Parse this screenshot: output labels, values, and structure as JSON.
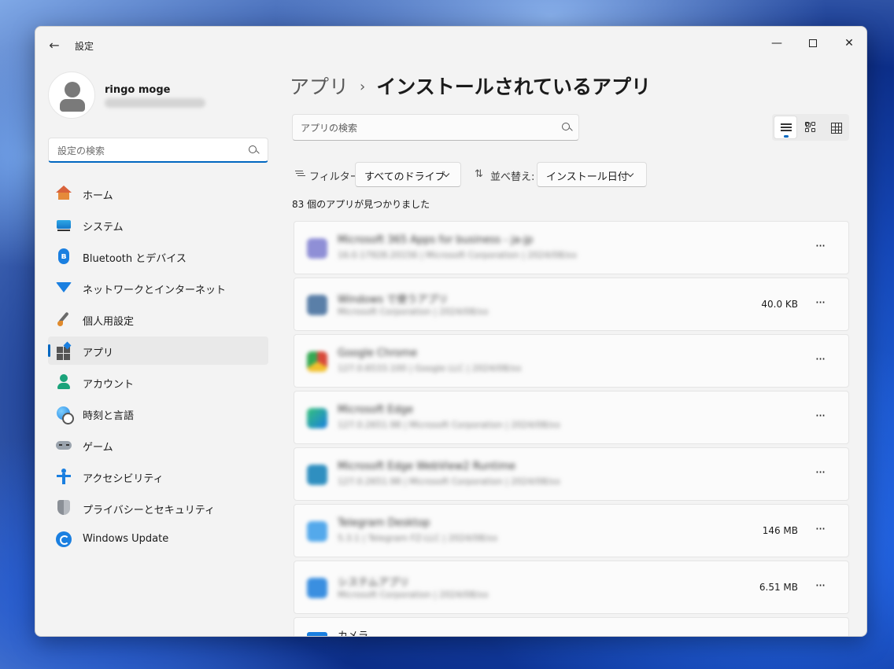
{
  "window": {
    "title": "設定"
  },
  "profile": {
    "name": "ringo moge"
  },
  "sidebar": {
    "search_placeholder": "設定の検索",
    "items": [
      {
        "label": "ホーム",
        "icon": "home-icon"
      },
      {
        "label": "システム",
        "icon": "system-icon"
      },
      {
        "label": "Bluetooth とデバイス",
        "icon": "bluetooth-icon"
      },
      {
        "label": "ネットワークとインターネット",
        "icon": "wifi-icon"
      },
      {
        "label": "個人用設定",
        "icon": "brush-icon"
      },
      {
        "label": "アプリ",
        "icon": "apps-icon",
        "active": true
      },
      {
        "label": "アカウント",
        "icon": "account-icon"
      },
      {
        "label": "時刻と言語",
        "icon": "time-language-icon"
      },
      {
        "label": "ゲーム",
        "icon": "game-controller-icon"
      },
      {
        "label": "アクセシビリティ",
        "icon": "accessibility-icon"
      },
      {
        "label": "プライバシーとセキュリティ",
        "icon": "shield-icon"
      },
      {
        "label": "Windows Update",
        "icon": "update-icon"
      }
    ]
  },
  "main": {
    "breadcrumb": {
      "parent": "アプリ",
      "separator": "›",
      "current": "インストールされているアプリ"
    },
    "search_placeholder": "アプリの検索",
    "filter": {
      "label": "フィルター:",
      "value": "すべてのドライブ"
    },
    "sort": {
      "label": "並べ替え:",
      "value": "インストール日付"
    },
    "count_text": "83 個のアプリが見つかりました",
    "more_label": "···",
    "apps": [
      {
        "name": "Microsoft 365 Apps for business - ja-jp",
        "meta": "16.0.17928.20156  |  Microsoft Corporation  |  2024/08/xx",
        "size": "",
        "icon_color": "#8f8fd6"
      },
      {
        "name": "Windows で使うアプリ",
        "meta": "Microsoft Corporation  |  2024/08/xx",
        "size": "40.0 KB",
        "icon_color": "#5a7fa8"
      },
      {
        "name": "Google Chrome",
        "meta": "127.0.6533.100  |  Google LLC  |  2024/08/xx",
        "size": "",
        "icon_color": "#d84a3a"
      },
      {
        "name": "Microsoft Edge",
        "meta": "127.0.2651.98  |  Microsoft Corporation  |  2024/08/xx",
        "size": "",
        "icon_color": "#2aa39a"
      },
      {
        "name": "Microsoft Edge WebView2 Runtime",
        "meta": "127.0.2651.98  |  Microsoft Corporation  |  2024/08/xx",
        "size": "",
        "icon_color": "#2f8fc0"
      },
      {
        "name": "Telegram Desktop",
        "meta": "5.3.1  |  Telegram FZ-LLC  |  2024/08/xx",
        "size": "146 MB",
        "icon_color": "#54a9eb"
      },
      {
        "name": "システムアプリ",
        "meta": "Microsoft Corporation  |  2024/08/xx",
        "size": "6.51 MB",
        "icon_color": "#3a8fe0"
      }
    ],
    "partial_app": {
      "name": "カメラ"
    }
  }
}
